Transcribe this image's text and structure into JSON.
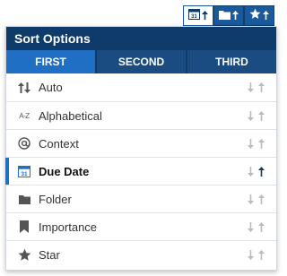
{
  "toolbar": {
    "buttons": [
      {
        "icon": "calendar-icon",
        "calendar_number": "31",
        "arrow": "up-arrow-icon",
        "active": true
      },
      {
        "icon": "folder-icon",
        "arrow": "up-arrow-icon",
        "active": false
      },
      {
        "icon": "star-icon",
        "arrow": "up-arrow-icon",
        "active": false
      }
    ]
  },
  "panel": {
    "title": "Sort Options",
    "tabs": [
      {
        "label": "FIRST",
        "active": true
      },
      {
        "label": "SECOND",
        "active": false
      },
      {
        "label": "THIRD",
        "active": false
      }
    ],
    "options": [
      {
        "label": "Auto",
        "icon": "auto-sort-icon",
        "selected": false
      },
      {
        "label": "Alphabetical",
        "icon": "alphabetical-icon",
        "icon_text": "A-Z",
        "selected": false
      },
      {
        "label": "Context",
        "icon": "at-sign-icon",
        "selected": false
      },
      {
        "label": "Due Date",
        "icon": "calendar-icon",
        "icon_text": "31",
        "selected": true
      },
      {
        "label": "Folder",
        "icon": "folder-icon",
        "selected": false
      },
      {
        "label": "Importance",
        "icon": "bookmark-icon",
        "selected": false
      },
      {
        "label": "Star",
        "icon": "star-icon",
        "selected": false
      }
    ]
  },
  "colors": {
    "header_bg": "#0f3b6b",
    "tab_active": "#1f6fc4",
    "tab_inactive": "#1a4c82",
    "arrow_inactive": "#b8bcc0",
    "arrow_active": "#0f3b6b"
  }
}
